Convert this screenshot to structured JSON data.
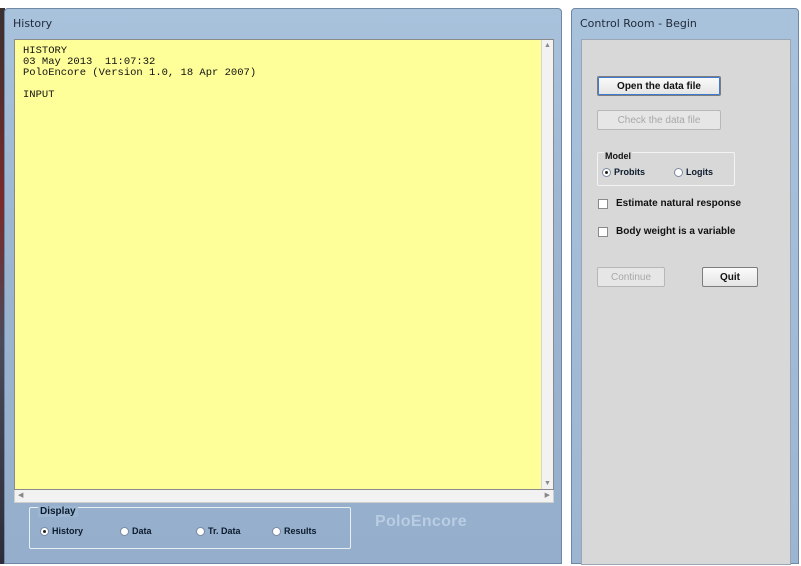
{
  "history_window": {
    "title": "History",
    "content_lines": [
      "HISTORY",
      "03 May 2013  11:07:32",
      "PoloEncore (Version 1.0, 18 Apr 2007)",
      "",
      "INPUT"
    ],
    "display_group": {
      "label": "Display",
      "options": [
        "History",
        "Data",
        "Tr. Data",
        "Results"
      ],
      "selected": "History"
    },
    "watermark": "PoloEncore"
  },
  "control_window": {
    "title": "Control Room - Begin",
    "open_button": "Open the data file",
    "check_button": "Check the data file",
    "model_group": {
      "label": "Model",
      "options": [
        "Probits",
        "Logits"
      ],
      "selected": "Probits"
    },
    "estimate_checkbox": "Estimate natural response",
    "bodyweight_checkbox": "Body weight is a variable",
    "continue_button": "Continue",
    "quit_button": "Quit"
  },
  "colors": {
    "history_background": "#ffff99",
    "window_frame": "#9cb6d2"
  }
}
